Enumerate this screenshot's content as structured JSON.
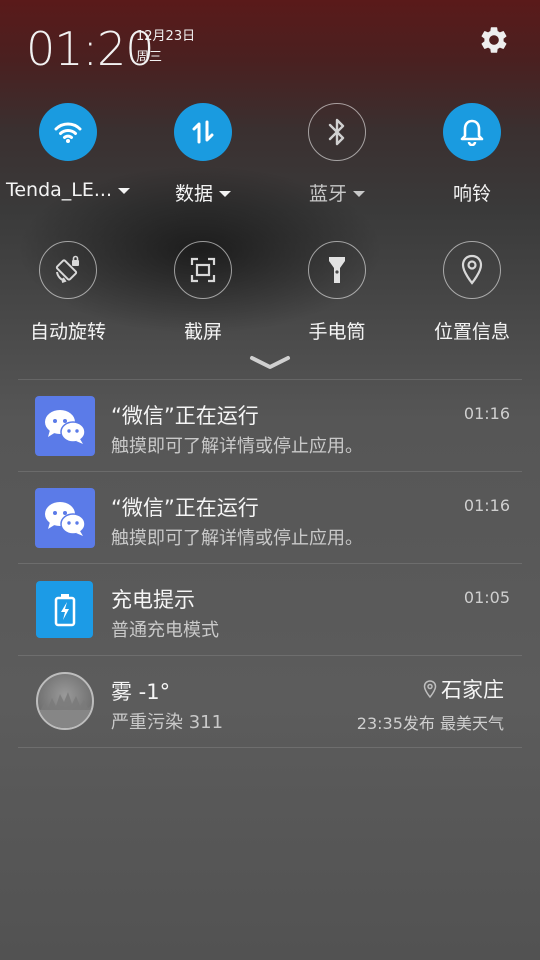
{
  "header": {
    "time": "01:20",
    "date": "12月23日",
    "weekday": "周三",
    "settings_icon": "gear-icon"
  },
  "toggles_row1": [
    {
      "label": "Tenda_LE...",
      "state": "on",
      "icon": "wifi-icon",
      "dropdown": true
    },
    {
      "label": "数据",
      "state": "on",
      "icon": "data-arrows-icon",
      "dropdown": true
    },
    {
      "label": "蓝牙",
      "state": "off",
      "icon": "bluetooth-icon",
      "dropdown": true
    },
    {
      "label": "响铃",
      "state": "on",
      "icon": "bell-icon",
      "dropdown": false
    }
  ],
  "toggles_row2": [
    {
      "label": "自动旋转",
      "state": "off",
      "icon": "rotate-lock-icon"
    },
    {
      "label": "截屏",
      "state": "off",
      "icon": "screenshot-icon"
    },
    {
      "label": "手电筒",
      "state": "off",
      "icon": "flashlight-icon"
    },
    {
      "label": "位置信息",
      "state": "off",
      "icon": "location-pin-icon"
    }
  ],
  "notifications": [
    {
      "title": "“微信”正在运行",
      "body": "触摸即可了解详情或停止应用。",
      "time": "01:16",
      "icon": "wechat-icon"
    },
    {
      "title": "“微信”正在运行",
      "body": "触摸即可了解详情或停止应用。",
      "time": "01:16",
      "icon": "wechat-icon"
    },
    {
      "title": "充电提示",
      "body": "普通充电模式",
      "time": "01:05",
      "icon": "battery-charging-icon"
    }
  ],
  "weather": {
    "title": "雾 -1°",
    "body": "严重污染 311",
    "city": "石家庄",
    "source": "23:35发布 最美天气"
  },
  "colors": {
    "accent": "#1a9be0",
    "wechat": "#5b7be8",
    "charging": "#1c9be6"
  }
}
